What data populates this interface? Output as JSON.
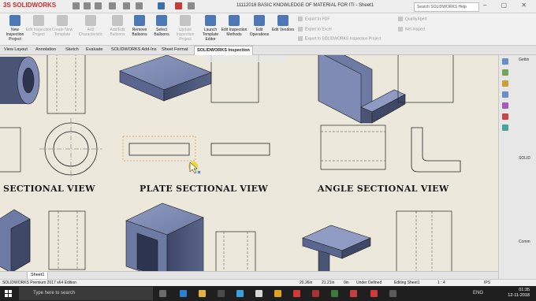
{
  "titlebar": {
    "logo_text": "3S SOLIDWORKS",
    "document_title": "11112018 BASIC KNOWLEDGE OF MATERIAL FOR ITI - Sheet1",
    "help_search_placeholder": "Search SOLIDWORKS Help",
    "window_controls": "–  ▢  ✕"
  },
  "ribbon": {
    "buttons": [
      {
        "label": "New Inspection Project",
        "enabled": true
      },
      {
        "label": "Edit Inspection Project",
        "enabled": false
      },
      {
        "label": "Create New Template",
        "enabled": false
      },
      {
        "label": "Add Characteristic",
        "enabled": false
      },
      {
        "label": "Add/Edit Balloons",
        "enabled": false
      },
      {
        "label": "Remove Balloons",
        "enabled": true
      },
      {
        "label": "Select Balloons",
        "enabled": true
      },
      {
        "label": "Update Inspection Project",
        "enabled": false
      },
      {
        "label": "Launch Template Editor",
        "enabled": true
      },
      {
        "label": "Edit Inspection Methods",
        "enabled": true
      },
      {
        "label": "Edit Operations",
        "enabled": true
      },
      {
        "label": "Edit Vendors",
        "enabled": true
      }
    ],
    "export_items": [
      "Export to PDF",
      "Export to Excel",
      "Export to SOLIDWORKS Inspection Project"
    ],
    "other_items": [
      "QualityXpert",
      "Net-Inspect"
    ]
  },
  "tabs": [
    "View Layout",
    "Annotation",
    "Sketch",
    "Evaluate",
    "SOLIDWORKS Add-Ins",
    "Sheet Format",
    "SOLIDWORKS Inspection"
  ],
  "active_tab": "SOLIDWORKS Inspection",
  "drawing": {
    "labels": [
      "SECTIONAL VIEW",
      "PLATE SECTIONAL VIEW",
      "ANGLE SECTIONAL VIEW"
    ]
  },
  "right_panel": {
    "heading_top": "Gettin",
    "heading_mid": "SOLID",
    "heading_low": "Comm"
  },
  "sheet_tab": "Sheet1",
  "statusbar": {
    "edition": "SOLIDWORKS Premium 2017 x64 Edition",
    "x": "20.26in",
    "y": "21.21in",
    "z": "0in",
    "state": "Under Defined",
    "editing": "Editing Sheet1",
    "scale": "1 : 4",
    "units": "IPS"
  },
  "taskbar": {
    "search_placeholder": "Type here to search",
    "time": "01:35",
    "date": "12-11-2018",
    "tray_text": "ENG"
  },
  "colors": {
    "accent": "#4c79b5",
    "canvas": "#ece9dc",
    "solid_face": "#6d7aa3",
    "logo": "#d12b2b"
  }
}
